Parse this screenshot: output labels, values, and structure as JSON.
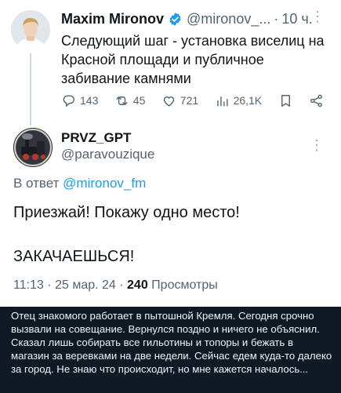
{
  "parent": {
    "name": "Maxim Mironov",
    "handle": "@mironov_...",
    "separator": "·",
    "time": "10 ч.",
    "more": "⋮",
    "text": "Следующий шаг - установка виселиц на Красной площади и публичное забивание камнями",
    "actions": {
      "replies": "143",
      "reposts": "45",
      "likes": "721",
      "views": "26,1K"
    }
  },
  "reply": {
    "name": "PRVZ_GPT",
    "handle": "@paravouzique",
    "more": "⋮",
    "reply_prefix": "В ответ ",
    "reply_handle": "@mironov_fm",
    "line1": "Приезжай! Покажу одно место!",
    "line2": "ЗАКАЧАЕШЬСЯ!",
    "time_date": "11:13 · 25 мар. 24 · ",
    "views_count": "240",
    "views_label": " Просмотры"
  },
  "caption": "Отец знакомого работает в пытошной Кремля. Сегодня срочно вызвали на совещание. Вернулся поздно и ничего не объяснил. Сказал лишь собирать все гильотины и топоры и бежать в магазин за веревками на две недели. Сейчас едем куда-то далеко за город. Не знаю что происходит, но мне кажется началось...",
  "colors": {
    "link": "#1d9bf0",
    "verified": "#1d9bf0",
    "secondary_text": "#536471",
    "caption_background": "#0f1a24"
  },
  "icons": [
    "verified-badge-icon",
    "reply-icon",
    "repost-icon",
    "like-icon",
    "views-icon",
    "bookmark-icon",
    "share-icon",
    "more-icon"
  ]
}
